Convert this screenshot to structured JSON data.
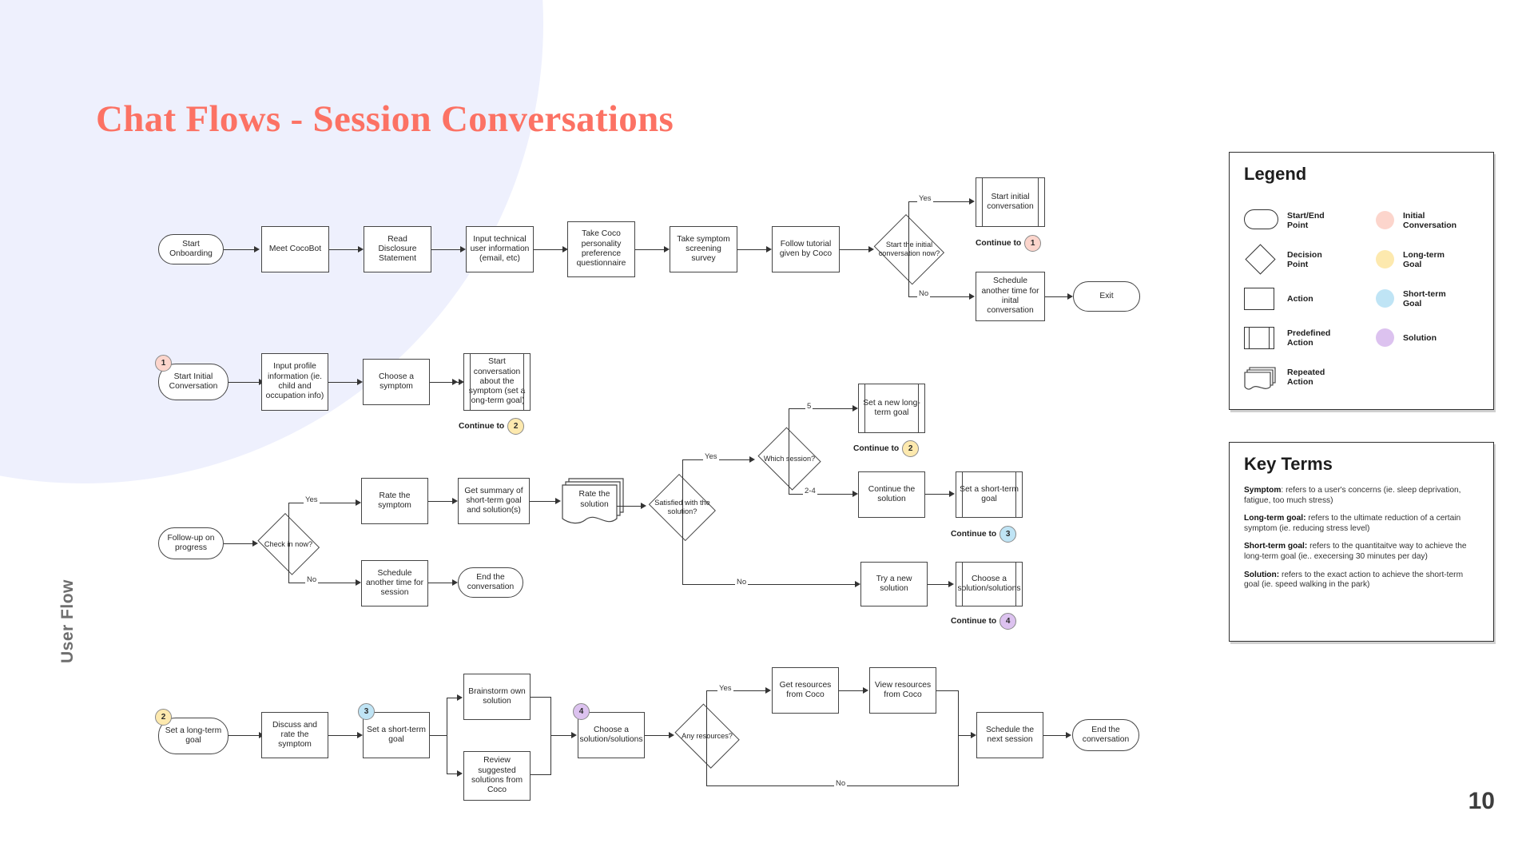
{
  "slide": {
    "title": "Chat Flows - Session Conversations",
    "side_label": "User Flow",
    "page_number": "10"
  },
  "colors": {
    "title": "#fc7264",
    "background_blob": "#eef0fd",
    "initial_conversation": "#fcd5cc",
    "long_term_goal": "#fde9ae",
    "short_term_goal": "#bfe4f5",
    "solution": "#dcc2ef"
  },
  "legend": {
    "title": "Legend",
    "shape_items": [
      {
        "icon": "stadium-icon",
        "label": "Start/End\nPoint"
      },
      {
        "icon": "diamond-icon",
        "label": "Decision\nPoint"
      },
      {
        "icon": "rectangle-icon",
        "label": "Action"
      },
      {
        "icon": "predefined-action-icon",
        "label": "Predefined\nAction"
      },
      {
        "icon": "repeated-action-icon",
        "label": "Repeated\nAction"
      }
    ],
    "color_items": [
      {
        "icon": "circle-icon",
        "color": "#fcd5cc",
        "label": "Initial\nConversation"
      },
      {
        "icon": "circle-icon",
        "color": "#fde9ae",
        "label": "Long-term\nGoal"
      },
      {
        "icon": "circle-icon",
        "color": "#bfe4f5",
        "label": "Short-term\nGoal"
      },
      {
        "icon": "circle-icon",
        "color": "#dcc2ef",
        "label": "Solution"
      }
    ]
  },
  "key_terms": {
    "title": "Key Terms",
    "items": [
      {
        "term": "Symptom",
        "sep": ": ",
        "definition": "refers to a user's concerns (ie. sleep deprivation, fatigue, too much stress)"
      },
      {
        "term": "Long-term goal:",
        "sep": " ",
        "definition": "refers to the ultimate reduction of a certain symptom (ie. reducing stress level)"
      },
      {
        "term": "Short-term goal:",
        "sep": " ",
        "definition": "refers to the quantitaitve way to achieve the long-term goal (ie.. execersing 30 minutes per day)"
      },
      {
        "term": "Solution:",
        "sep": " ",
        "definition": "refers to the exact action to achieve the short-term goal (ie.  speed walking in the park)"
      }
    ]
  },
  "flow": {
    "row1": {
      "n1": "Start Onboarding",
      "n2": "Meet CocoBot",
      "n3": "Read Disclosure Statement",
      "n4": "Input technical user information (email, etc)",
      "n5": "Take Coco personality preference questionnaire",
      "n6": "Take symptom screening survey",
      "n7": "Follow tutorial given by Coco",
      "d1": "Start the initial conversation now?",
      "d1_yes": "Yes",
      "d1_no": "No",
      "n8": "Start initial conversation",
      "n9": "Schedule another time for inital conversation",
      "n10": "Exit",
      "continue_label": "Continue to",
      "continue_badge": "1"
    },
    "row2": {
      "badge": "1",
      "n1": "Start Initial Conversation",
      "n2": "Input profile information (ie. child and occupation info)",
      "n3": "Choose a symptom",
      "n4": "Start conversation about the symptom (set a long-term goal)",
      "continue_label": "Continue to",
      "continue_badge": "2"
    },
    "row3": {
      "n1": "Follow-up on progress",
      "d1": "Check in now?",
      "d1_yes": "Yes",
      "d1_no": "No",
      "n2": "Rate the symptom",
      "n3": "Get summary of short-term goal and solution(s)",
      "n4": "Rate the solution",
      "d2": "Satisfied with the solution?",
      "d2_yes": "Yes",
      "d2_no": "No",
      "n5": "Schedule another time for session",
      "n6": "End the conversation",
      "d3": "Which session?",
      "d3_a": "5",
      "d3_b": "2-4",
      "n7": "Set a new long-term goal",
      "n7_continue_label": "Continue to",
      "n7_continue_badge": "2",
      "n8": "Continue the solution",
      "n9": "Set a short-term goal",
      "n9_continue_label": "Continue to",
      "n9_continue_badge": "3",
      "n10": "Try a new solution",
      "n11": "Choose a solution/solutions",
      "n11_continue_label": "Continue to",
      "n11_continue_badge": "4"
    },
    "row4": {
      "badge1": "2",
      "n1": "Set a long-term goal",
      "n2": "Discuss and rate the symptom",
      "badge2": "3",
      "n3": "Set a short-term goal",
      "n4": "Brainstorm own solution",
      "n5": "Review suggested solutions from Coco",
      "badge3": "4",
      "n6": "Choose a solution/solutions",
      "d1": "Any resources?",
      "d1_yes": "Yes",
      "d1_no": "No",
      "n7": "Get resources from Coco",
      "n8": "View resources from Coco",
      "n9": "Schedule the next session",
      "n10": "End the conversation"
    }
  }
}
